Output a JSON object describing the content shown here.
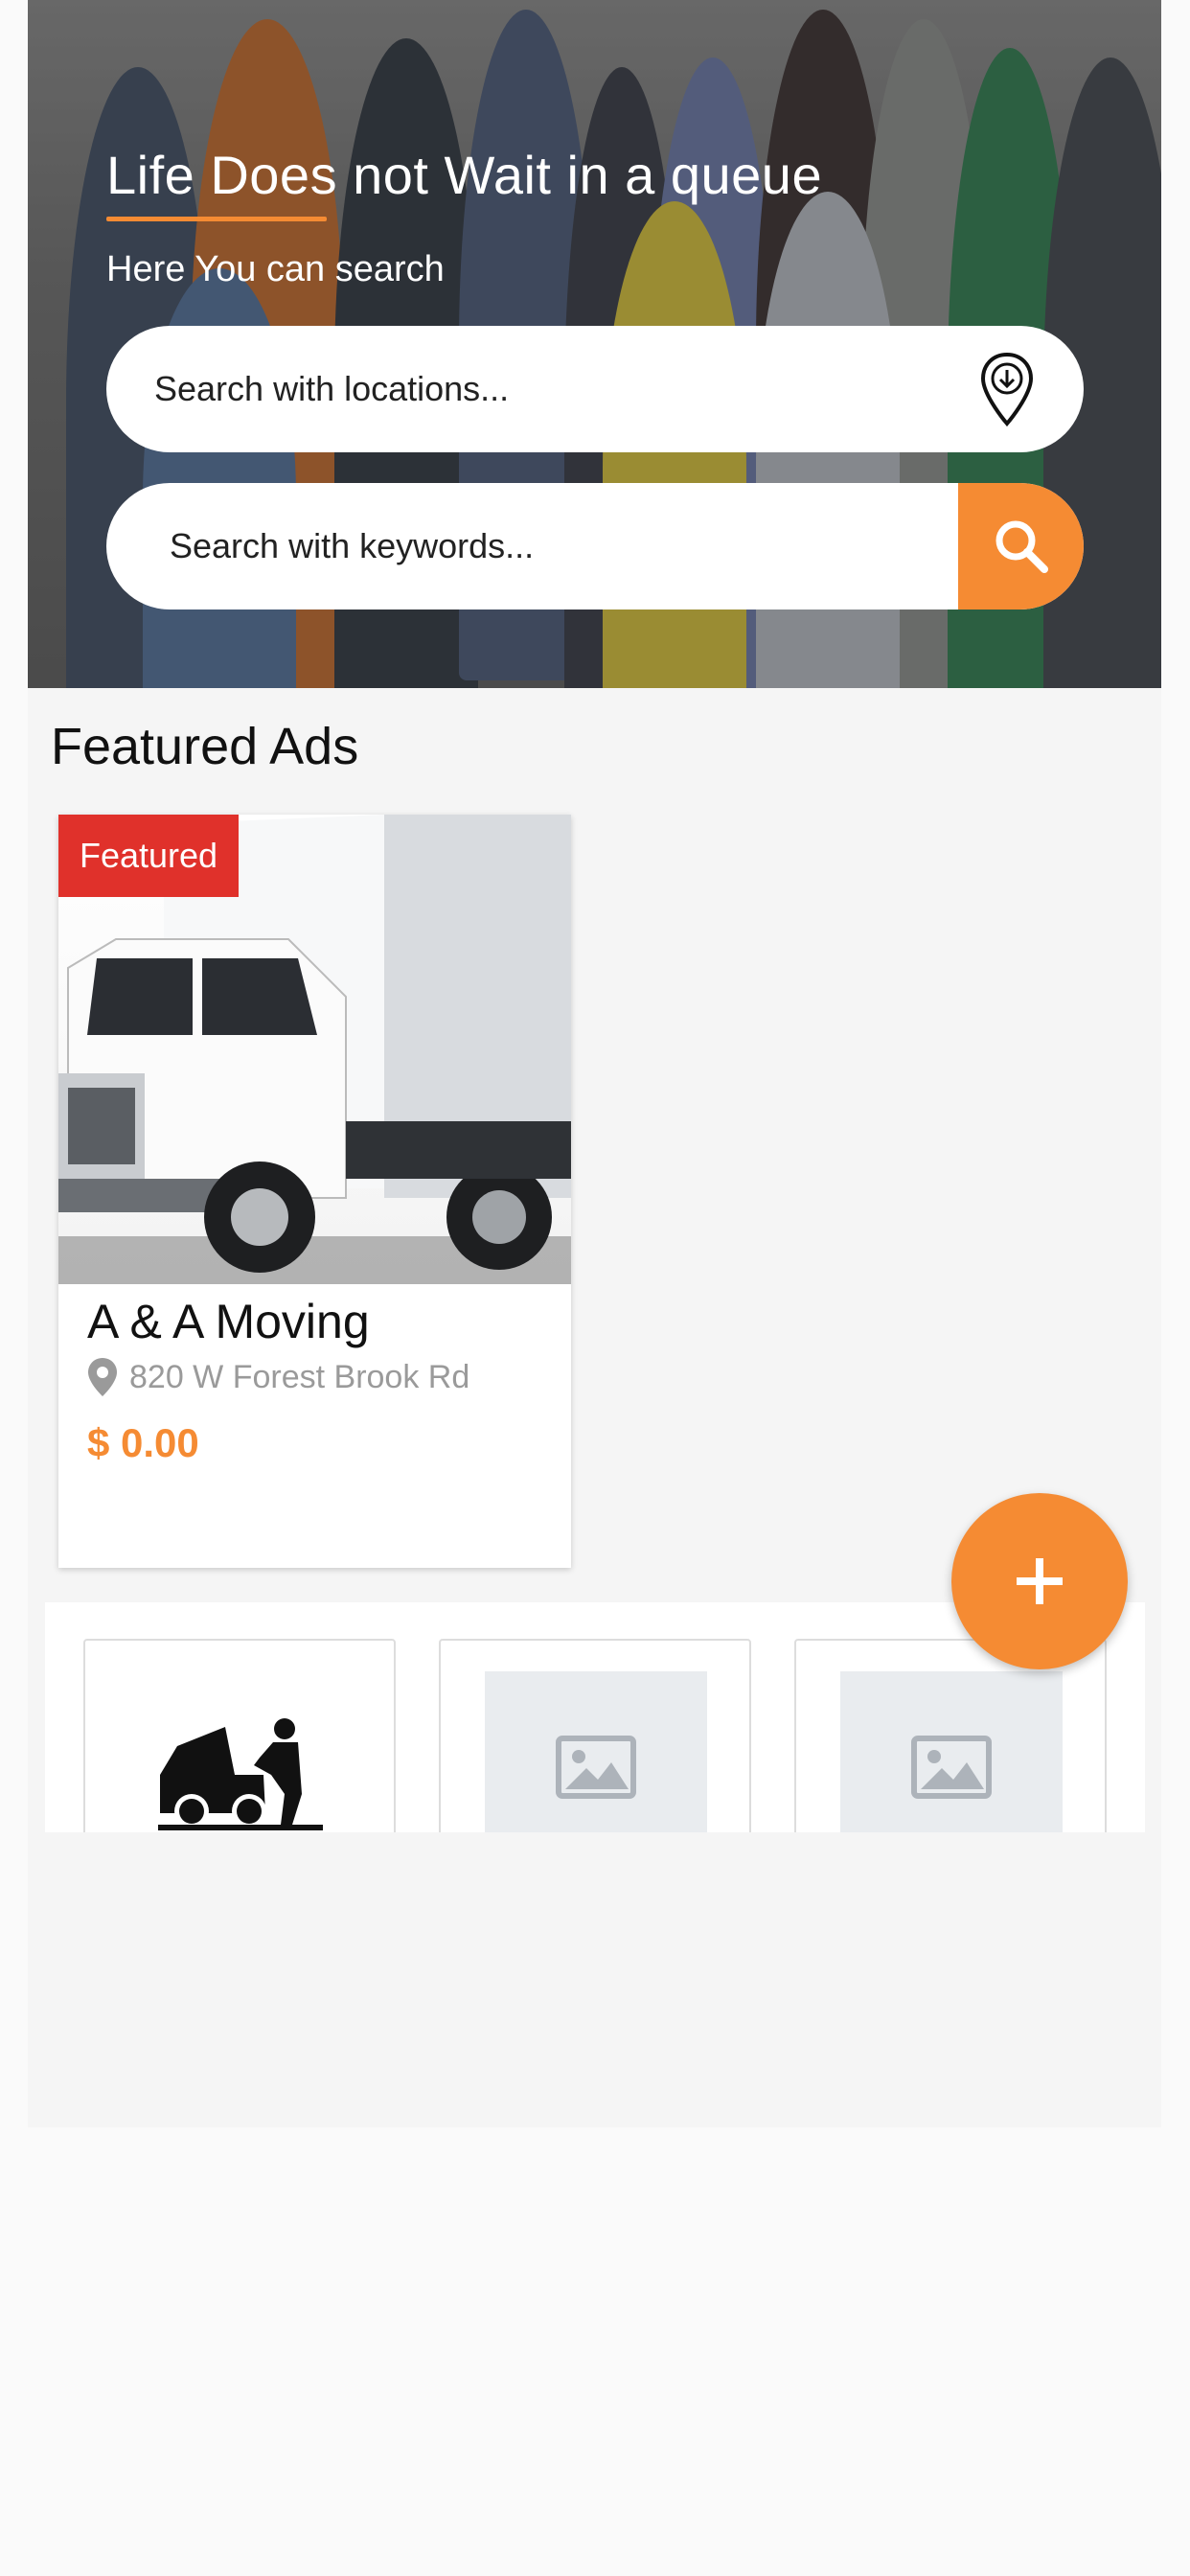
{
  "hero": {
    "title": "Life Does not Wait in a queue",
    "subtitle": "Here You can search",
    "location_placeholder": "Search with locations...",
    "keyword_placeholder": "Search with keywords...",
    "location_icon": "map-pin-download-icon",
    "search_icon": "magnifier-icon"
  },
  "featured": {
    "section_title": "Featured Ads",
    "cards": [
      {
        "badge": "Featured",
        "title": "A & A Moving",
        "address": "820 W Forest Brook Rd",
        "price": "$ 0.00",
        "image": "box-truck-photo"
      }
    ]
  },
  "categories": [
    {
      "icon": "mechanic-car-repair-icon"
    },
    {
      "icon": "image-placeholder-icon"
    },
    {
      "icon": "image-placeholder-icon"
    }
  ],
  "fab": {
    "icon": "plus-icon"
  },
  "colors": {
    "accent": "#f58b33",
    "badge": "#e0312b",
    "background": "#f5f5f5"
  }
}
